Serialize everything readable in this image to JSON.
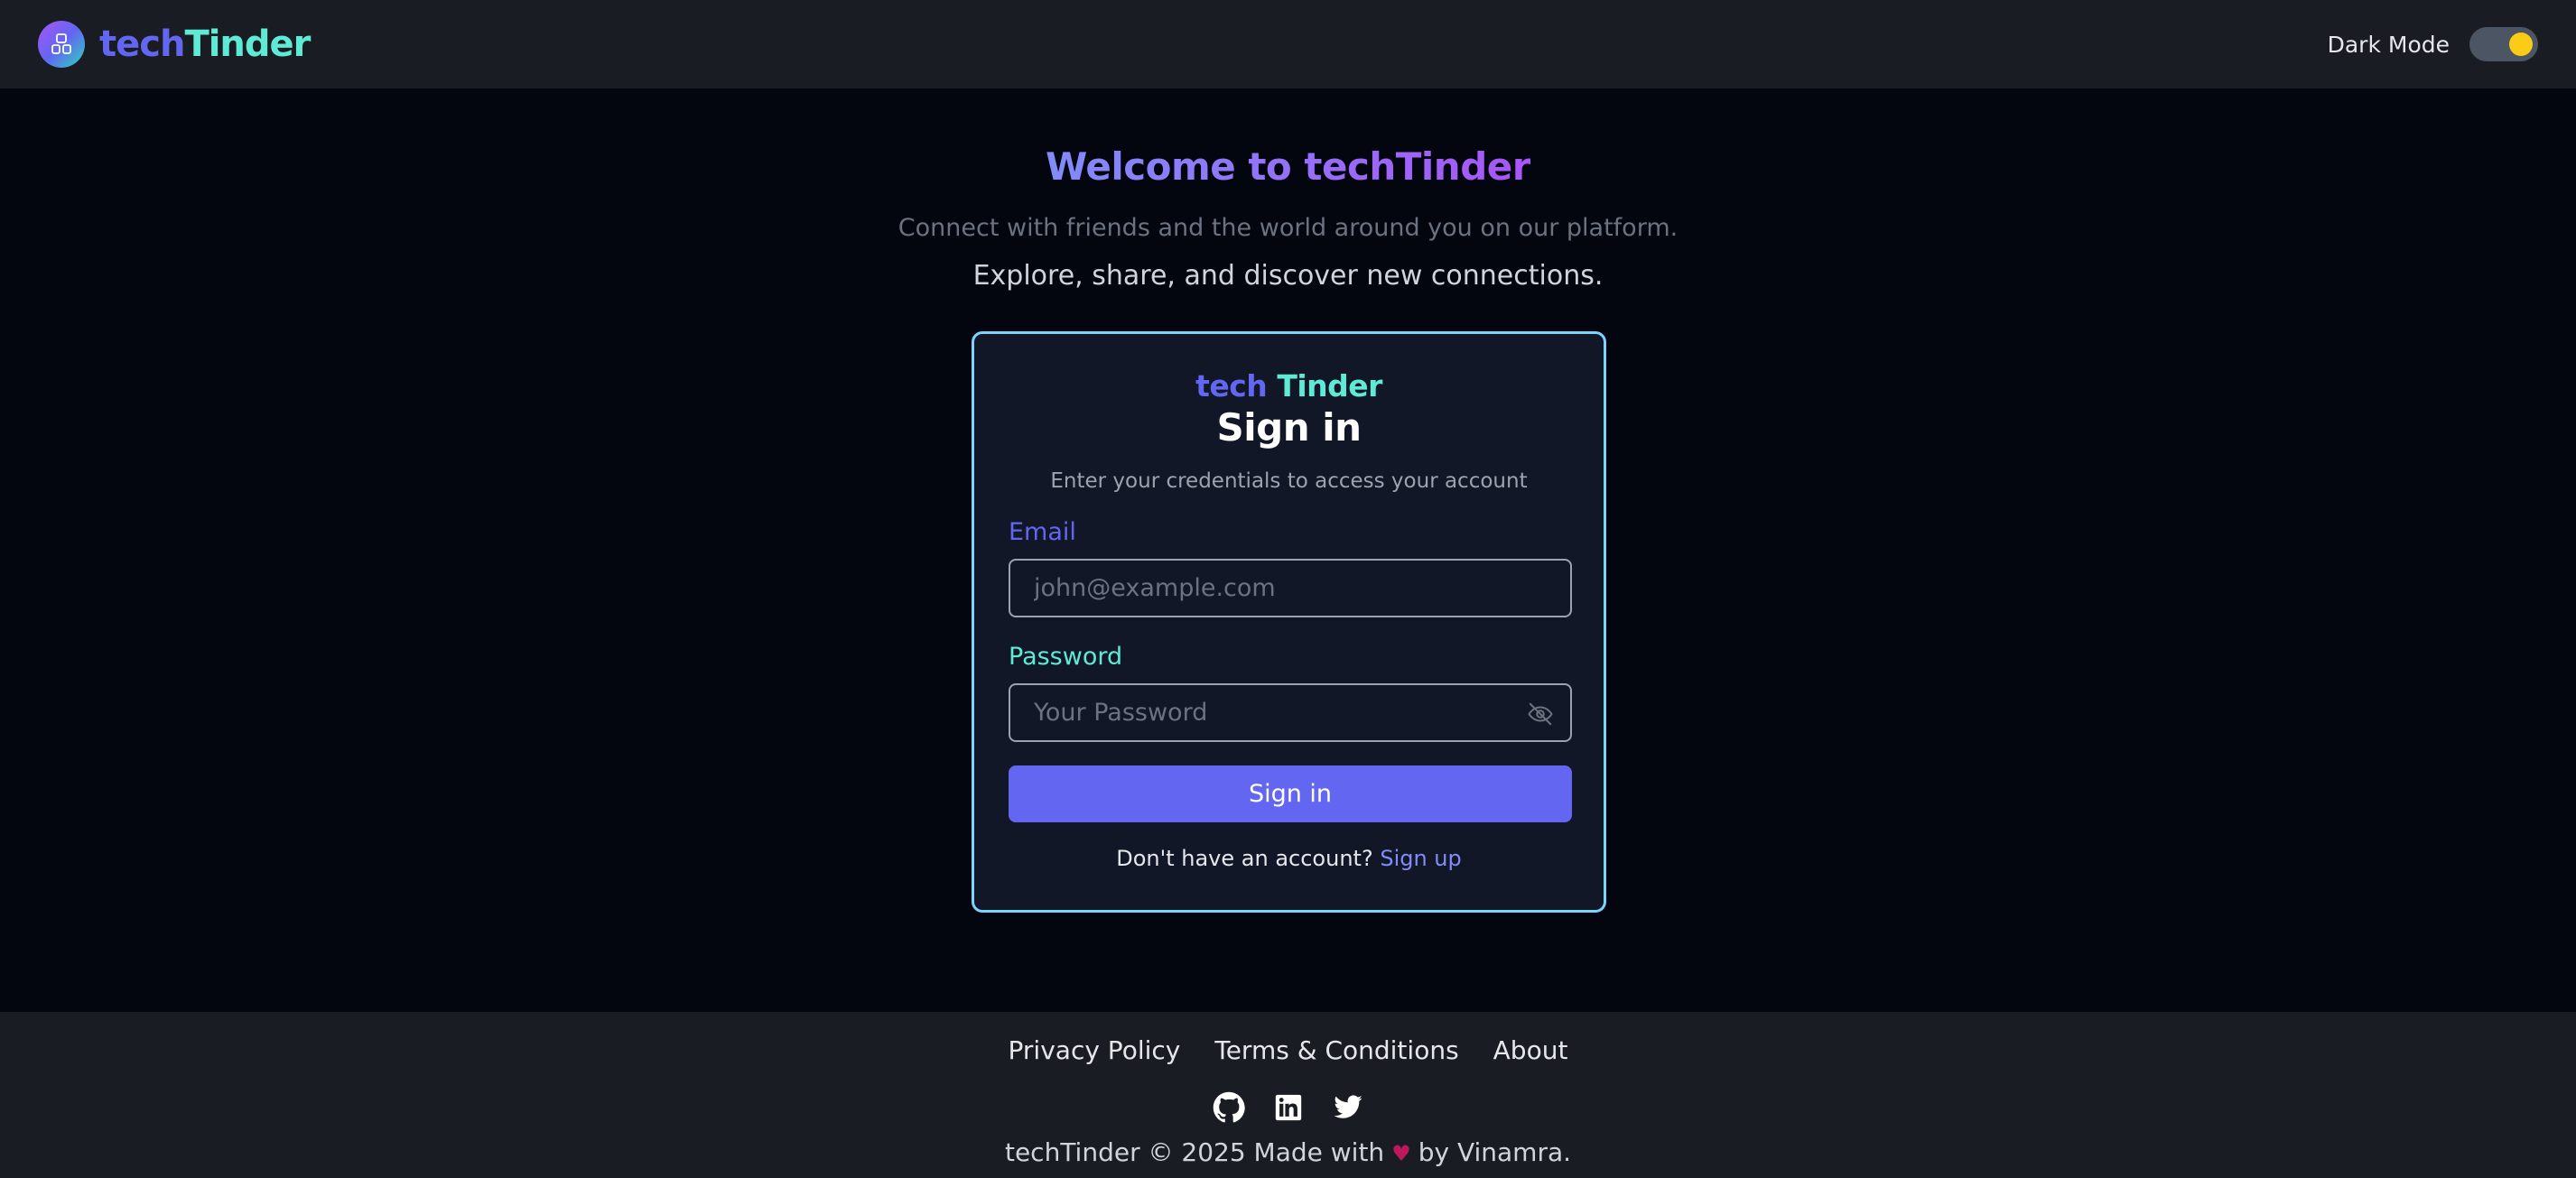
{
  "header": {
    "brand_tech": "tech",
    "brand_tinder": "Tinder",
    "theme_label": "Dark Mode",
    "dark_mode_on": true,
    "logo_icon": "people-icon"
  },
  "hero": {
    "title": "Welcome to techTinder",
    "subtitle": "Connect with friends and the world around you on our platform.",
    "tagline": "Explore, share, and discover new connections."
  },
  "signin_card": {
    "brand_tech": "tech",
    "brand_tinder": "Tinder",
    "title": "Sign in",
    "description": "Enter your credentials to access your account",
    "email_label": "Email",
    "email_placeholder": "john@example.com",
    "email_value": "",
    "password_label": "Password",
    "password_placeholder": "Your Password",
    "password_value": "",
    "password_visibility_icon": "eye-off-icon",
    "submit_label": "Sign in",
    "signup_prompt": "Don't have an account?",
    "signup_link": "Sign up"
  },
  "footer": {
    "links": [
      "Privacy Policy",
      "Terms & Conditions",
      "About"
    ],
    "socials": [
      "github-icon",
      "linkedin-icon",
      "twitter-icon"
    ],
    "copyright_prefix": "techTinder © 2025 Made with",
    "copyright_suffix": "by Vinamra.",
    "heart": "♥"
  },
  "colors": {
    "accent": "#6366f1",
    "teal": "#5eead4",
    "card_border": "#7dd3fc",
    "background": "#03050f",
    "bar": "#191c22"
  }
}
